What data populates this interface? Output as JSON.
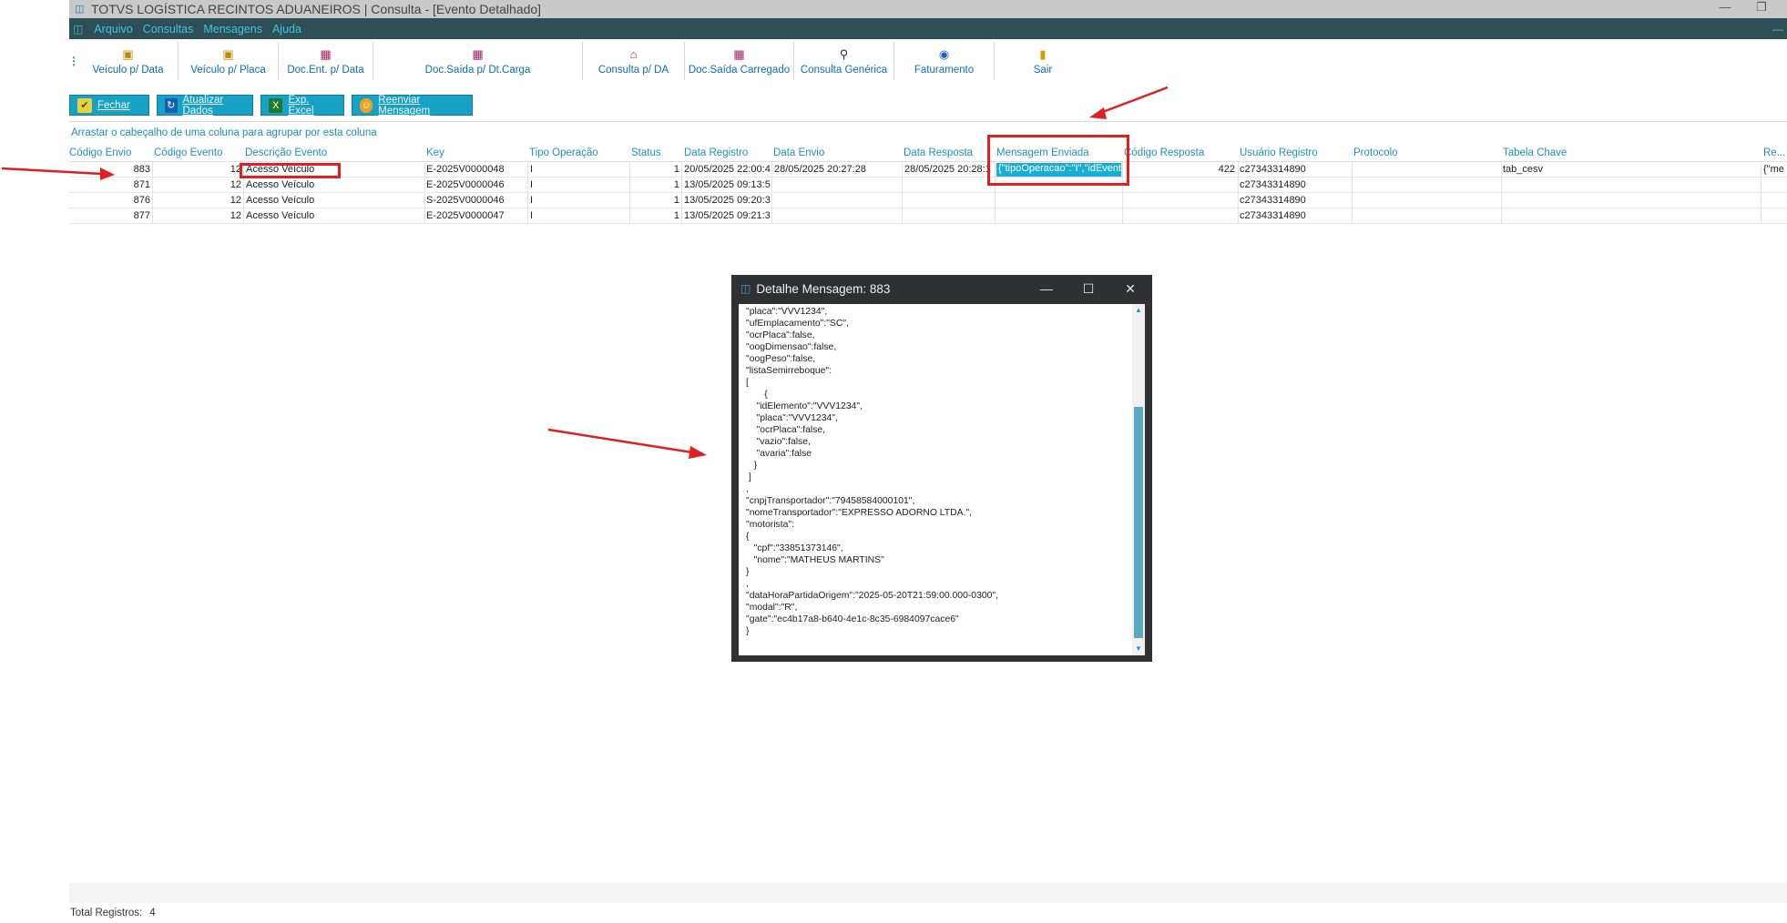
{
  "window": {
    "title": "TOTVS LOGÍSTICA RECINTOS ADUANEIROS | Consulta - [Evento Detalhado]"
  },
  "menu": {
    "items": [
      "Arquivo",
      "Consultas",
      "Mensagens",
      "Ajuda"
    ]
  },
  "toolbar": {
    "buttons": [
      {
        "label": "Veículo p/ Data",
        "icon": "truck-calendar-icon"
      },
      {
        "label": "Veículo p/ Placa",
        "icon": "truck-plate-icon"
      },
      {
        "label": "Doc.Ent. p/ Data",
        "icon": "document-entry-icon"
      },
      {
        "label": "Doc.Saída p/ Dt.Carga",
        "icon": "document-exit-icon"
      },
      {
        "label": "Consulta p/ DA",
        "icon": "house-search-icon"
      },
      {
        "label": "Doc.Saída Carregado",
        "icon": "document-loaded-icon"
      },
      {
        "label": "Consulta Genérica",
        "icon": "magnifier-icon"
      },
      {
        "label": "Faturamento",
        "icon": "billing-icon"
      },
      {
        "label": "Sair",
        "icon": "exit-door-icon"
      }
    ]
  },
  "actions": {
    "close": "Fechar",
    "refresh": "Atualizar Dados",
    "export": "Exp. Excel",
    "resend": "Reenviar Mensagem"
  },
  "grid": {
    "group_hint": "Arrastar o cabeçalho de uma coluna para agrupar por esta coluna",
    "columns": [
      "Código Envio",
      "Código Evento",
      "Descrição Evento",
      "Key",
      "Tipo Operação",
      "Status",
      "Data Registro",
      "Data Envio",
      "Data Resposta",
      "Mensagem Enviada",
      "Código Resposta",
      "Usuário Registro",
      "Protocolo",
      "Tabela Chave",
      "Re..."
    ],
    "rows": [
      {
        "codigo_envio": "883",
        "codigo_evento": "12",
        "descricao": "Acesso Veículo",
        "key": "E-2025V0000048",
        "tipo": "I",
        "status": "1",
        "data_registro": "20/05/2025 22:00:4",
        "data_envio": "28/05/2025 20:27:28",
        "data_resposta": "28/05/2025 20:28:1",
        "mensagem": "{\"tipoOperacao\":\"I\",\"idEvent",
        "codigo_resposta": "422",
        "usuario": "c27343314890",
        "protocolo": "",
        "tabela": "tab_cesv",
        "re": "{\"me"
      },
      {
        "codigo_envio": "871",
        "codigo_evento": "12",
        "descricao": "Acesso Veículo",
        "key": "E-2025V0000046",
        "tipo": "I",
        "status": "1",
        "data_registro": "13/05/2025 09:13:5",
        "data_envio": "",
        "data_resposta": "",
        "mensagem": "",
        "codigo_resposta": "",
        "usuario": "c27343314890",
        "protocolo": "",
        "tabela": "",
        "re": ""
      },
      {
        "codigo_envio": "876",
        "codigo_evento": "12",
        "descricao": "Acesso Veículo",
        "key": "S-2025V0000046",
        "tipo": "I",
        "status": "1",
        "data_registro": "13/05/2025 09:20:3",
        "data_envio": "",
        "data_resposta": "",
        "mensagem": "",
        "codigo_resposta": "",
        "usuario": "c27343314890",
        "protocolo": "",
        "tabela": "",
        "re": ""
      },
      {
        "codigo_envio": "877",
        "codigo_evento": "12",
        "descricao": "Acesso Veículo",
        "key": "E-2025V0000047",
        "tipo": "I",
        "status": "1",
        "data_registro": "13/05/2025 09:21:3",
        "data_envio": "",
        "data_resposta": "",
        "mensagem": "",
        "codigo_resposta": "",
        "usuario": "c27343314890",
        "protocolo": "",
        "tabela": "",
        "re": ""
      }
    ]
  },
  "dialog": {
    "title": "Detalhe Mensagem:  883",
    "content": "\"placa\":\"VVV1234\",\n\"ufEmplacamento\":\"SC\",\n\"ocrPlaca\":false,\n\"oogDimensao\":false,\n\"oogPeso\":false,\n\"listaSemirreboque\":\n[\n       {\n    \"idElemento\":\"VVV1234\",\n    \"placa\":\"VVV1234\",\n    \"ocrPlaca\":false,\n    \"vazio\":false,\n    \"avaria\":false\n   }\n ]\n,\n\"cnpjTransportador\":\"79458584000101\",\n\"nomeTransportador\":\"EXPRESSO ADORNO LTDA.\",\n\"motorista\":\n{\n   \"cpf\":\"33851373146\",\n   \"nome\":\"MATHEUS MARTINS\"\n}\n,\n\"dataHoraPartidaOrigem\":\"2025-05-20T21:59:00.000-0300\",\n\"modal\":\"R\",\n\"gate\":\"ec4b17a8-b640-4e1c-8c35-6984097cace6\"\n}"
  },
  "footer": {
    "label": "Total Registros:",
    "count": "4"
  },
  "colors": {
    "accent": "#19aed4",
    "menubar": "#2f4f56",
    "annotation": "#e02020"
  }
}
